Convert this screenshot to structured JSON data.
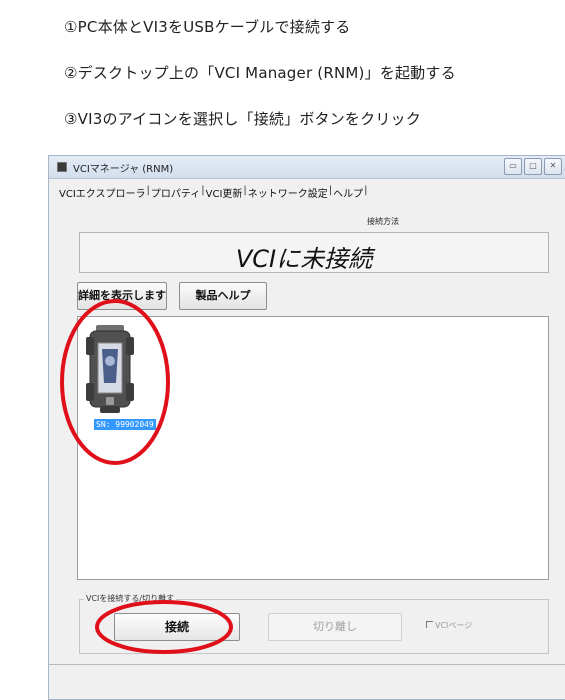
{
  "instructions": {
    "step1": "①PC本体とVI3をUSBケーブルで接続する",
    "step2": "②デスクトップ上の「VCI Manager (RNM)」を起動する",
    "step3": "③VI3のアイコンを選択し「接続」ボタンをクリック"
  },
  "window": {
    "title": "VCIマネージャ (RNM)",
    "tabs": [
      "VCIエクスプローラ",
      "プロパティ",
      "VCI更新",
      "ネットワーク設定",
      "ヘルプ"
    ],
    "connection_method_label": "接続方法",
    "status": "VCIに未接続",
    "details_button": "詳細を表示します",
    "product_help_button": "製品ヘルプ",
    "device": {
      "label": "SN: 99902049",
      "icon": "vci-device-icon"
    },
    "group_label": "VCIを接続する/切り離す",
    "connect_button": "接続",
    "disconnect_button": "切り離し",
    "vci_page_checkbox": "VCIページ"
  },
  "colors": {
    "annotation_red": "#e0101a",
    "selection_blue": "#3399ff"
  }
}
